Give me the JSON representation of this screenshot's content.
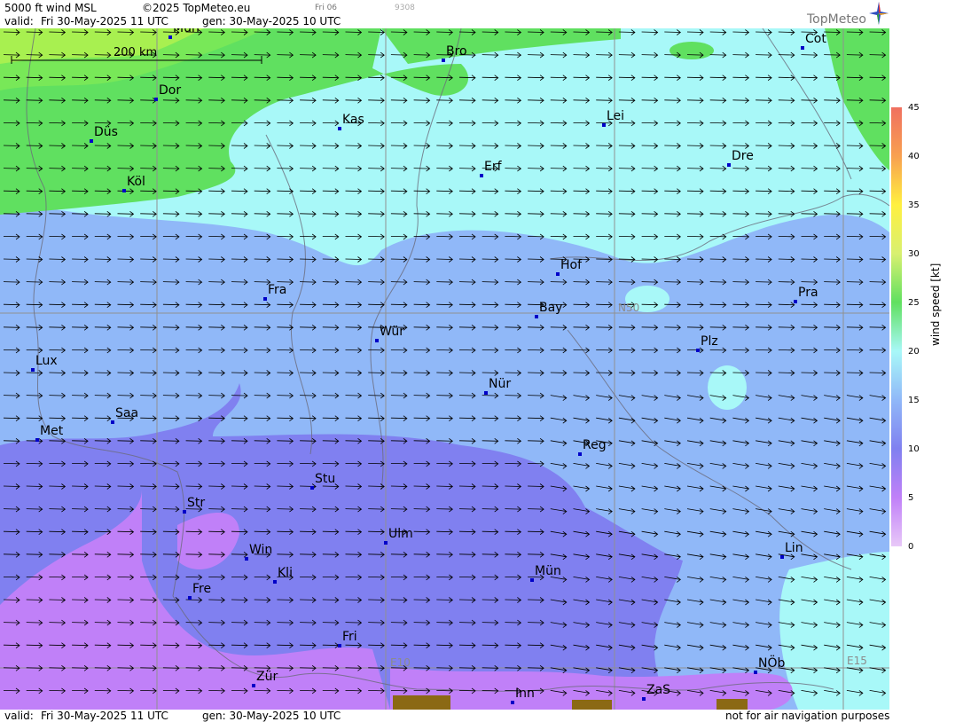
{
  "header": {
    "product": "5000 ft wind MSL",
    "copyright": "©2025 TopMeteo.eu",
    "run": "Fri 06",
    "code": "9308",
    "valid_label": "valid:",
    "valid_time": "Fri  30-May-2025  11 UTC",
    "gen": "gen: 30-May-2025 10 UTC"
  },
  "footer": {
    "valid_label": "valid:",
    "valid_time": "Fri  30-May-2025  11 UTC",
    "gen": "gen: 30-May-2025 10 UTC",
    "disclaimer": "not for air navigation purposes"
  },
  "logo": {
    "text": "TopMeteo",
    "icon": "compass-star-icon"
  },
  "scale_bar": "200 km",
  "grid_labels": {
    "lat": "N50",
    "lon1": "E10",
    "lon2": "E15"
  },
  "legend": {
    "title": "wind speed [kt]",
    "ticks": [
      "45",
      "40",
      "35",
      "30",
      "25",
      "20",
      "15",
      "10",
      "5",
      "0"
    ],
    "colors": [
      "#f07060",
      "#f8a050",
      "#fff040",
      "#d8f070",
      "#60e060",
      "#a8f8f8",
      "#90b8f8",
      "#8080f0",
      "#c080f8",
      "#e8c8f8"
    ]
  },
  "cities": [
    {
      "name": "Mün"
    },
    {
      "name": "Bro"
    },
    {
      "name": "Cot"
    },
    {
      "name": "Dor"
    },
    {
      "name": "Kas"
    },
    {
      "name": "Düs"
    },
    {
      "name": "Lei"
    },
    {
      "name": "Erf"
    },
    {
      "name": "Dre"
    },
    {
      "name": "Köl"
    },
    {
      "name": "Hof"
    },
    {
      "name": "Fra"
    },
    {
      "name": "Pra"
    },
    {
      "name": "Bay"
    },
    {
      "name": "Wür"
    },
    {
      "name": "Plz"
    },
    {
      "name": "Lux"
    },
    {
      "name": "Nür"
    },
    {
      "name": "Saa"
    },
    {
      "name": "Met"
    },
    {
      "name": "Reg"
    },
    {
      "name": "Stu"
    },
    {
      "name": "Str"
    },
    {
      "name": "Ulm"
    },
    {
      "name": "Win"
    },
    {
      "name": "Lin"
    },
    {
      "name": "Kli"
    },
    {
      "name": "Mün"
    },
    {
      "name": "Fre"
    },
    {
      "name": "Fri"
    },
    {
      "name": "NÖb"
    },
    {
      "name": "Zür"
    },
    {
      "name": "ZaS"
    },
    {
      "name": "Inn"
    }
  ],
  "wind_direction": "west-to-east"
}
